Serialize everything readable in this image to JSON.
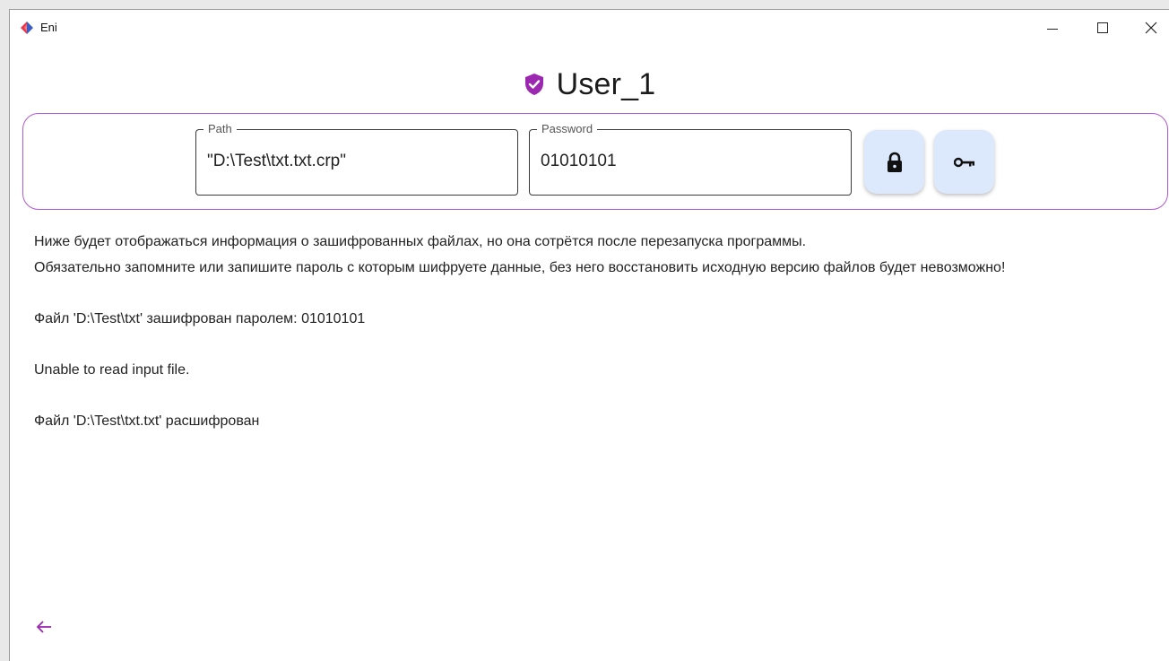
{
  "window": {
    "title": "Eni"
  },
  "header": {
    "user_name": "User_1"
  },
  "form": {
    "path_label": "Path",
    "path_value": "\"D:\\Test\\txt.txt.crp\"",
    "password_label": "Password",
    "password_value": "01010101"
  },
  "icons": {
    "app": "app-logo-icon",
    "shield": "shield-check-icon",
    "encrypt": "lock-icon",
    "decrypt": "key-icon",
    "back": "arrow-left-icon"
  },
  "colors": {
    "accent": "#9c27b0",
    "panel_border": "#b35ad6",
    "button_bg": "#dce8fb",
    "logo_red": "#e8364b",
    "logo_blue": "#3b5cc4"
  },
  "log": {
    "info_line_1": "Ниже будет отображаться информация о зашифрованных файлах, но она сотрётся после перезапуска программы.",
    "info_line_2": "Обязательно запомните или запишите пароль с которым шифруете данные, без него восстановить исходную версию файлов будет невозможно!",
    "entry_1": "Файл 'D:\\Test\\txt' зашифрован паролем: 01010101",
    "entry_2": "Unable to read input file.",
    "entry_3": "Файл 'D:\\Test\\txt.txt' расшифрован"
  }
}
